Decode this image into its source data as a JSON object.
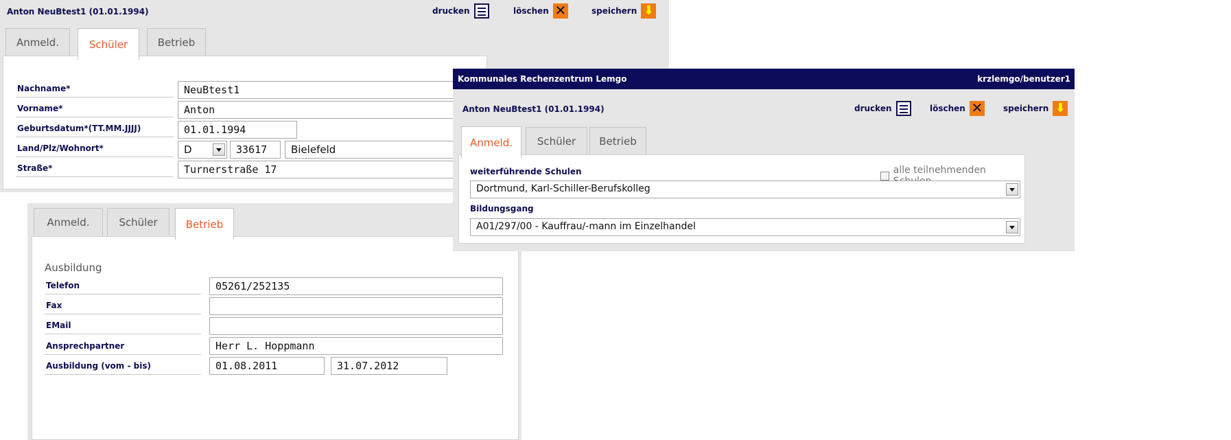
{
  "window1": {
    "title": "Anton NeuBtest1 (01.01.1994)",
    "actions": {
      "print": "drucken",
      "delete": "löschen",
      "save": "speichern"
    },
    "tabs": [
      "Anmeld.",
      "Schüler",
      "Betrieb"
    ],
    "fields": {
      "nachname_label": "Nachname*",
      "nachname_value": "NeuBtest1",
      "vorname_label": "Vorname*",
      "vorname_value": "Anton",
      "geb_label": "Geburtsdatum*(TT.MM.JJJJ)",
      "geb_value": "01.01.1994",
      "ort_label": "Land/Plz/Wohnort*",
      "land_value": "D",
      "plz_value": "33617",
      "ort_value": "Bielefeld",
      "strasse_label": "Straße*",
      "strasse_value": "Turnerstraße 17"
    }
  },
  "window2": {
    "tabs": [
      "Anmeld.",
      "Schüler",
      "Betrieb"
    ],
    "section": "Ausbildung",
    "fields": {
      "telefon_label": "Telefon",
      "telefon_value": "05261/252135",
      "fax_label": "Fax",
      "fax_value": "",
      "email_label": "EMail",
      "email_value": "",
      "ansprech_label": "Ansprechpartner",
      "ansprech_value": "Herr L. Hoppmann",
      "ausb_label": "Ausbildung (vom - bis)",
      "ausb_from": "01.08.2011",
      "ausb_to": "31.07.2012"
    }
  },
  "window3": {
    "org": "Kommunales Rechenzentrum Lemgo",
    "user": "krzlemgo/benutzer1",
    "title": "Anton NeuBtest1 (01.01.1994)",
    "actions": {
      "print": "drucken",
      "delete": "löschen",
      "save": "speichern"
    },
    "tabs": [
      "Anmeld.",
      "Schüler",
      "Betrieb"
    ],
    "schulen_label": "weiterführende Schulen",
    "alle_label": "alle teilnehmenden Schulen",
    "schule_value": "Dortmund, Karl-Schiller-Berufskolleg",
    "bildungsgang_label": "Bildungsgang",
    "bildungsgang_value": "A01/297/00 - Kauffrau/-mann im Einzelhandel"
  },
  "colors": {
    "accent": "#e85a24",
    "navy": "#0c0c5a",
    "panel": "#e6e6e6",
    "icon_orange": "#f07c14"
  }
}
